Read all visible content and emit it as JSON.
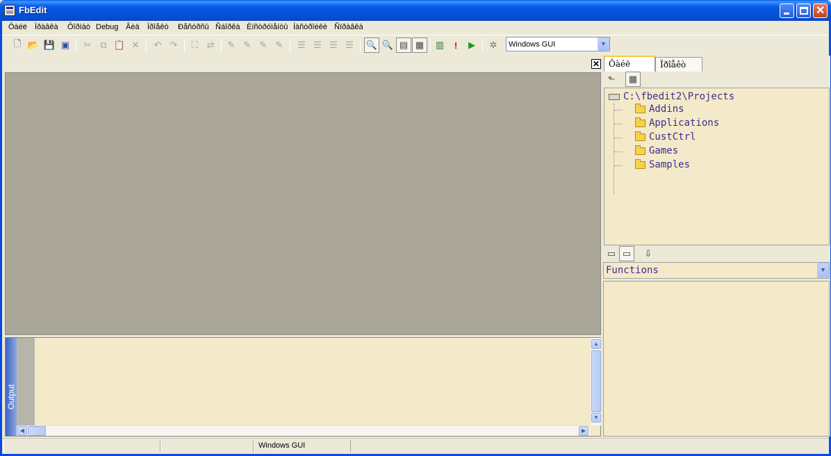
{
  "window": {
    "title": "FbEdit"
  },
  "menu": [
    "Ôàéë",
    "Ïðàâêà",
    "Ôîðìàò",
    "Debug",
    "Âèä",
    "Ïðîåêò",
    "Ðåñóðñû",
    "Ñáîðêà",
    "Èíñòðóìåíòû",
    "Íàñòðîéêè",
    "Ñïðàâêà"
  ],
  "toolbar": {
    "build_select_value": "Windows GUI"
  },
  "right_tabs": {
    "file": "Ôàéë",
    "project": "Ïðîåêò"
  },
  "filetree": {
    "root": "C:\\fbedit2\\Projects",
    "items": [
      "Addins",
      "Applications",
      "CustCtrl",
      "Games",
      "Samples"
    ]
  },
  "functions": {
    "selected": "Functions"
  },
  "output": {
    "label": "Output"
  },
  "status": {
    "build": "Windows GUI"
  },
  "colors": {
    "titlebar": "#0a5ae6",
    "panel_bg": "#f4e9c9",
    "editor_bg": "#aba798"
  }
}
